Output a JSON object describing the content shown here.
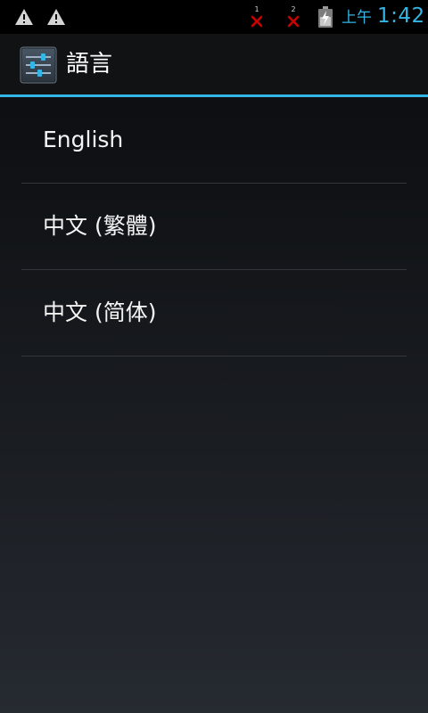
{
  "status_bar": {
    "icons": [
      "warning-icon",
      "warning-icon",
      "sim-off-icon",
      "sim-off-icon",
      "battery-charging-icon"
    ],
    "sim_slots": [
      "1",
      "2"
    ],
    "ampm": "上午",
    "time": "1:42",
    "accent_color": "#33b5e5",
    "sim_error_color": "#cc0000"
  },
  "action_bar": {
    "icon": "settings-sliders-icon",
    "title": "語言"
  },
  "languages": [
    {
      "label": "English"
    },
    {
      "label": "中文 (繁體)"
    },
    {
      "label": "中文 (简体)"
    }
  ]
}
